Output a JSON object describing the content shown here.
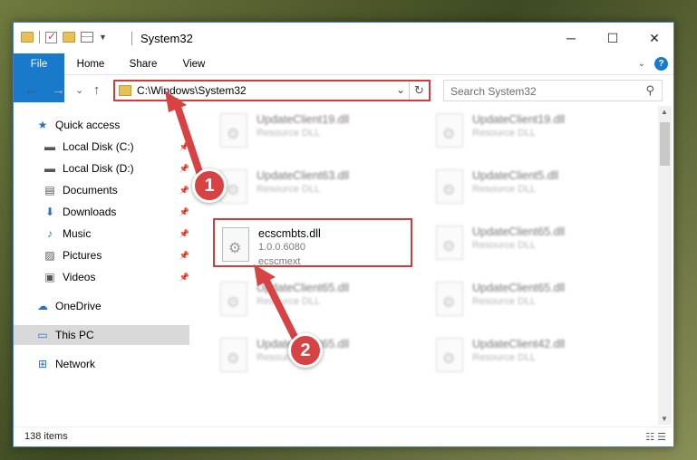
{
  "window": {
    "title": "System32",
    "controls": {
      "minimize": "─",
      "maximize": "☐",
      "close": "✕"
    }
  },
  "ribbon": {
    "tabs": [
      "File",
      "Home",
      "Share",
      "View"
    ]
  },
  "navigation": {
    "back": "←",
    "forward": "→",
    "recent": "⌄",
    "up": "↑",
    "address": "C:\\Windows\\System32",
    "search_placeholder": "Search System32"
  },
  "sidebar": {
    "items": [
      {
        "label": "Quick access",
        "icon": "star-icon",
        "pinned": false
      },
      {
        "label": "Local Disk (C:)",
        "icon": "drive-icon",
        "pinned": true
      },
      {
        "label": "Local Disk (D:)",
        "icon": "drive-icon",
        "pinned": true
      },
      {
        "label": "Documents",
        "icon": "documents-icon",
        "pinned": true
      },
      {
        "label": "Downloads",
        "icon": "downloads-icon",
        "pinned": true
      },
      {
        "label": "Music",
        "icon": "music-icon",
        "pinned": true
      },
      {
        "label": "Pictures",
        "icon": "pictures-icon",
        "pinned": true
      },
      {
        "label": "Videos",
        "icon": "videos-icon",
        "pinned": true
      },
      {
        "label": "OneDrive",
        "icon": "onedrive-icon",
        "pinned": false
      },
      {
        "label": "This PC",
        "icon": "pc-icon",
        "pinned": false,
        "selected": true
      },
      {
        "label": "Network",
        "icon": "network-icon",
        "pinned": false
      }
    ]
  },
  "files": [
    {
      "name": "UpdateClient19.dll",
      "line2": "Resource DLL",
      "line3": "",
      "blurred": true
    },
    {
      "name": "UpdateClient19.dll",
      "line2": "Resource DLL",
      "line3": "",
      "blurred": true
    },
    {
      "name": "UpdateClient63.dll",
      "line2": "Resource DLL",
      "line3": "",
      "blurred": true
    },
    {
      "name": "UpdateClient5.dll",
      "line2": "Resource DLL",
      "line3": "",
      "blurred": true
    },
    {
      "name": "ecscmbts.dll",
      "line2": "1.0.0.6080",
      "line3": "ecscmext",
      "blurred": false,
      "highlighted": true
    },
    {
      "name": "UpdateClient65.dll",
      "line2": "Resource DLL",
      "line3": "",
      "blurred": true
    },
    {
      "name": "UpdateClient65.dll",
      "line2": "Resource DLL",
      "line3": "",
      "blurred": true
    },
    {
      "name": "UpdateClient65.dll",
      "line2": "Resource DLL",
      "line3": "",
      "blurred": true
    },
    {
      "name": "UpdateClient65.dll",
      "line2": "Resource DLL",
      "line3": "",
      "blurred": true
    },
    {
      "name": "UpdateClient42.dll",
      "line2": "Resource DLL",
      "line3": "",
      "blurred": true
    }
  ],
  "status": {
    "item_count": "138 items"
  },
  "callouts": [
    "1",
    "2"
  ],
  "colors": {
    "accent": "#1979ca",
    "highlight": "#d43a3a",
    "callout": "#d84242"
  }
}
